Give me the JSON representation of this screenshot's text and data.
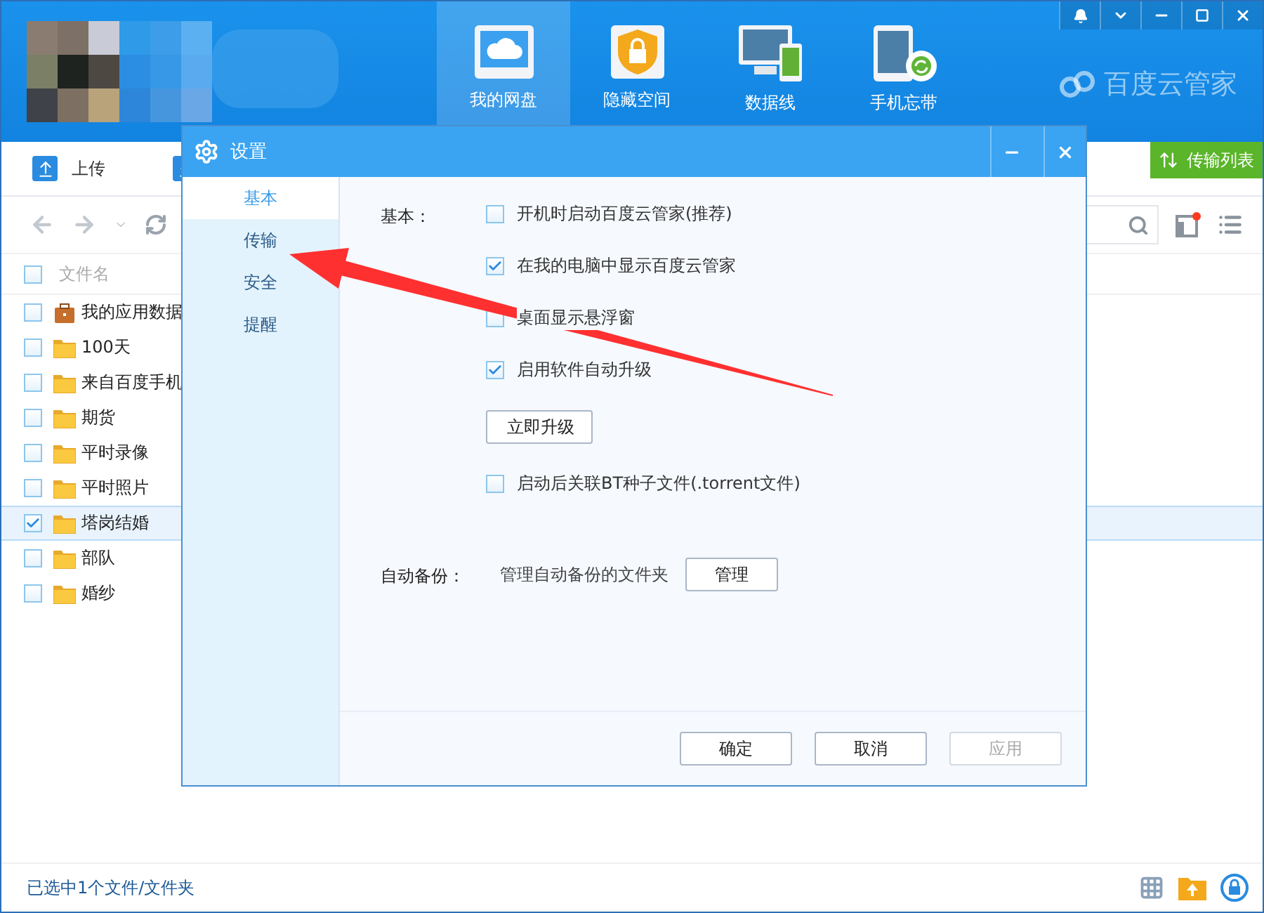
{
  "nav_tabs": [
    {
      "label": "我的网盘",
      "kind": "disk",
      "selected": true
    },
    {
      "label": "隐藏空间",
      "kind": "vault",
      "selected": false
    },
    {
      "label": "数据线",
      "kind": "cable",
      "selected": false
    },
    {
      "label": "手机忘带",
      "kind": "phone",
      "selected": false
    }
  ],
  "brand": "百度云管家",
  "toolbar": {
    "upload": "上传"
  },
  "transfer_button": "传输列表",
  "file_list": {
    "header": "文件名",
    "header_checked": false,
    "rows": [
      {
        "name": "我的应用数据",
        "kind": "app",
        "checked": false,
        "selected": false
      },
      {
        "name": "100天",
        "kind": "folder",
        "checked": false,
        "selected": false
      },
      {
        "name": "来自百度手机",
        "kind": "folder",
        "checked": false,
        "selected": false
      },
      {
        "name": "期货",
        "kind": "folder",
        "checked": false,
        "selected": false
      },
      {
        "name": "平时录像",
        "kind": "folder",
        "checked": false,
        "selected": false
      },
      {
        "name": "平时照片",
        "kind": "folder",
        "checked": false,
        "selected": false
      },
      {
        "name": "塔岗结婚",
        "kind": "folder",
        "checked": true,
        "selected": true
      },
      {
        "name": "部队",
        "kind": "folder",
        "checked": false,
        "selected": false
      },
      {
        "name": "婚纱",
        "kind": "folder",
        "checked": false,
        "selected": false
      }
    ]
  },
  "status_bar": "已选中1个文件/文件夹",
  "dialog": {
    "title": "设置",
    "nav": [
      {
        "label": "基本",
        "selected": true
      },
      {
        "label": "传输",
        "selected": false
      },
      {
        "label": "安全",
        "selected": false
      },
      {
        "label": "提醒",
        "selected": false
      }
    ],
    "section_label": "基本：",
    "options": [
      {
        "kind": "checkbox",
        "label": "开机时启动百度云管家(推荐)",
        "checked": false
      },
      {
        "kind": "checkbox",
        "label": "在我的电脑中显示百度云管家",
        "checked": true
      },
      {
        "kind": "checkbox",
        "label": "桌面显示悬浮窗",
        "checked": false
      },
      {
        "kind": "checkbox",
        "label": "启用软件自动升级",
        "checked": true
      },
      {
        "kind": "button",
        "label": "立即升级"
      },
      {
        "kind": "checkbox",
        "label": "启动后关联BT种子文件(.torrent文件)",
        "checked": false
      }
    ],
    "backup": {
      "label": "自动备份：",
      "text": "管理自动备份的文件夹",
      "button": "管理"
    },
    "buttons": [
      {
        "label": "确定",
        "disabled": false
      },
      {
        "label": "取消",
        "disabled": false
      },
      {
        "label": "应用",
        "disabled": true
      }
    ]
  }
}
